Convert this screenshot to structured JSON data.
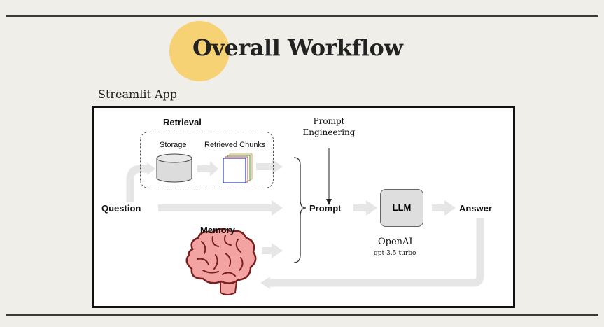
{
  "title": "Overall Workflow",
  "app_label": "Streamlit App",
  "retrieval": {
    "title": "Retrieval",
    "storage_label": "Storage",
    "chunks_label": "Retrieved Chunks"
  },
  "memory_label": "Memory",
  "question_label": "Question",
  "prompt_engineering_label": "Prompt Engineering",
  "prompt_label": "Prompt",
  "llm_label": "LLM",
  "answer_label": "Answer",
  "provider": {
    "name": "OpenAI",
    "model": "gpt-3.5-turbo"
  },
  "colors": {
    "background": "#efeee8",
    "accent_circle": "#f7cd5f",
    "flow_arrow": "#e6e6e6",
    "storage_fill": "#dcdcdc",
    "brain_fill": "#f4a3a3",
    "brain_outline": "#7a1f1f",
    "chunk_colors": [
      "#2f3fa8",
      "#e23b3b",
      "#2f9e44",
      "#e8a33a"
    ]
  },
  "icons": [
    "database-icon",
    "document-stack-icon",
    "brain-icon",
    "brace-icon"
  ]
}
